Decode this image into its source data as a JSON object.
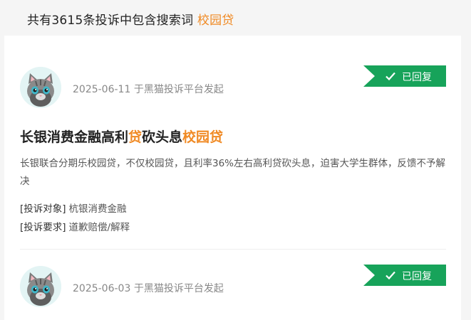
{
  "header": {
    "prefix": "共有3615条投诉中包含搜索词",
    "keyword": "校园贷"
  },
  "complaints": [
    {
      "date": "2025-06-11",
      "source": "于黑猫投诉平台发起",
      "status": "已回复",
      "title_a": "长银消费金融高利",
      "title_hl1": "贷",
      "title_b": "砍头息",
      "title_hl2": "校园贷",
      "description": "长银联合分期乐校园贷，不仅校园贷，且利率36%左右高利贷砍头息，迫害大学生群体，反馈不予解决",
      "target_label": "[投诉对象]",
      "target_value": "杭银消费金融",
      "demand_label": "[投诉要求]",
      "demand_value": "道歉赔偿/解释"
    },
    {
      "date": "2025-06-03",
      "source": "于黑猫投诉平台发起",
      "status": "已回复"
    }
  ],
  "colors": {
    "keyword": "#f08a24",
    "status_badge": "#17a35a"
  },
  "icons": {
    "avatar": "cat-avatar-icon",
    "check": "check-icon"
  }
}
